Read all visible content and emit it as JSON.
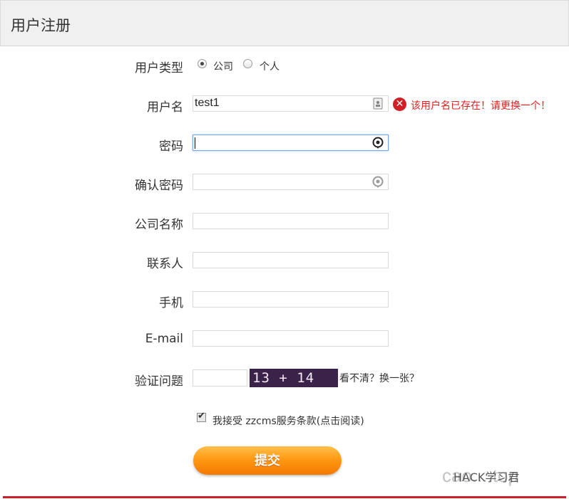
{
  "header": {
    "title": "用户注册"
  },
  "form": {
    "user_type": {
      "label": "用户类型",
      "options": [
        {
          "label": "公司",
          "checked": true
        },
        {
          "label": "个人",
          "checked": false
        }
      ]
    },
    "username": {
      "label": "用户名",
      "value": "test1",
      "icon": "id-card-icon",
      "error": "该用户名已存在！请更换一个！"
    },
    "password": {
      "label": "密码",
      "value": "",
      "icon": "password-reveal-icon"
    },
    "confirm_password": {
      "label": "确认密码",
      "value": "",
      "icon": "password-reveal-icon"
    },
    "company_name": {
      "label": "公司名称",
      "value": ""
    },
    "contact": {
      "label": "联系人",
      "value": ""
    },
    "phone": {
      "label": "手机",
      "value": ""
    },
    "email": {
      "label": "E-mail",
      "value": ""
    },
    "captcha": {
      "label": "验证问题",
      "value": "",
      "image_text": "13 + 14 =?",
      "refresh_label": "看不清？换一张？"
    },
    "agree": {
      "checked": true,
      "label": "我接受 zzcms服务条款(点击阅读)"
    },
    "submit_label": "提交"
  },
  "watermark": {
    "brand": "HACK学习君",
    "url_text": "cao....top"
  },
  "colors": {
    "accent": "#ff9a14",
    "error": "#e02020",
    "bottom_bar": "#c9202b"
  }
}
